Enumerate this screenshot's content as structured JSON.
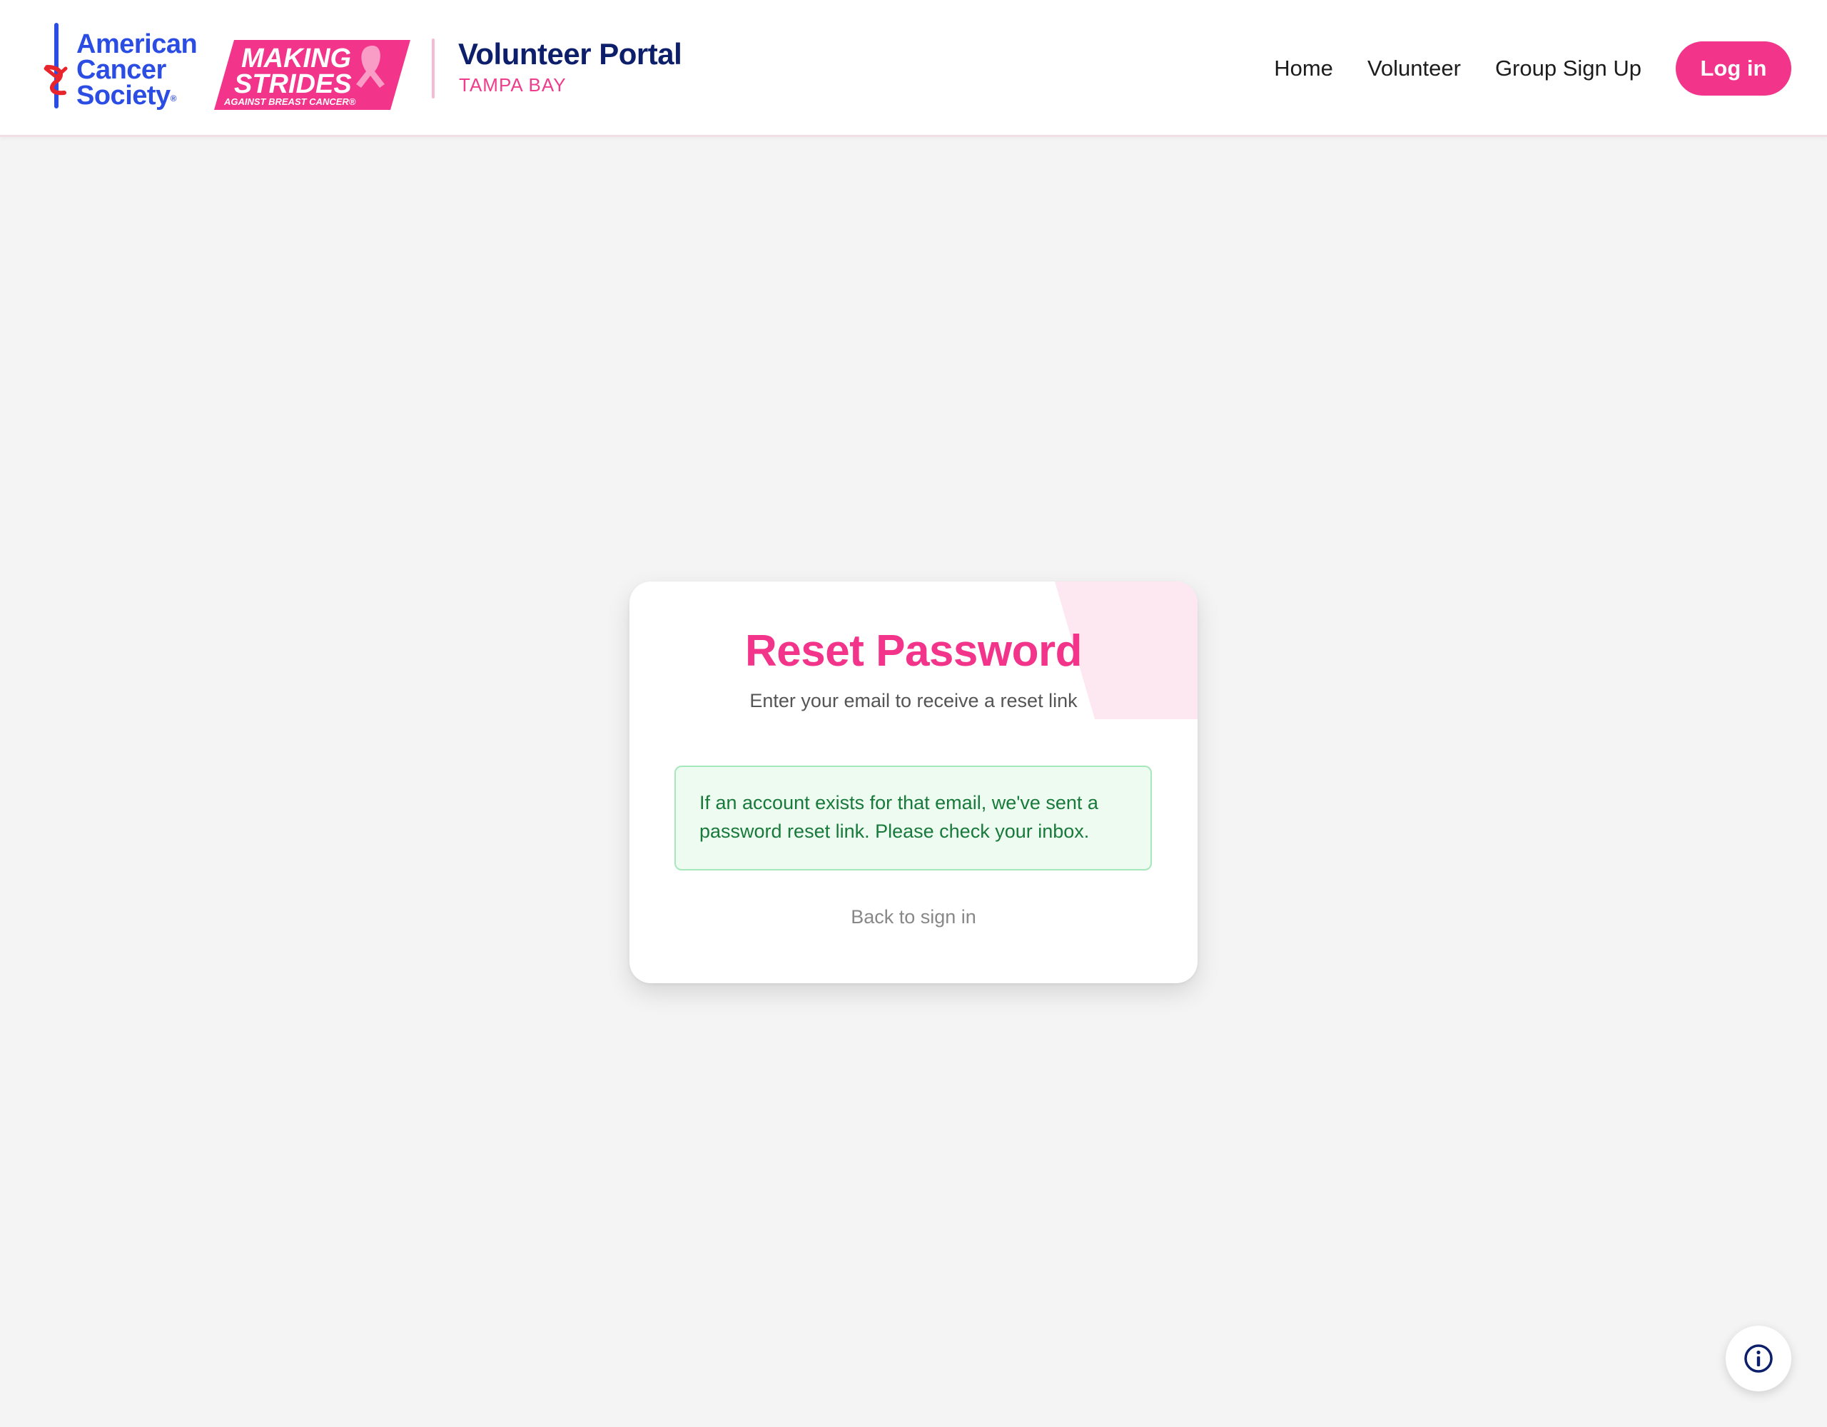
{
  "header": {
    "acs_logo": {
      "lines": [
        "American",
        "Cancer",
        "Society"
      ],
      "registered": "®",
      "color": "#2b4de3"
    },
    "strides_logo": {
      "lines": [
        "MAKING",
        "STRIDES",
        "AGAINST BREAST CANCER®"
      ],
      "color": "#f2348a"
    },
    "portal_title": "Volunteer Portal",
    "portal_subtitle": "TAMPA BAY",
    "nav": {
      "home": "Home",
      "volunteer": "Volunteer",
      "group_sign_up": "Group Sign Up",
      "login": "Log in"
    }
  },
  "card": {
    "title": "Reset Password",
    "subtitle": "Enter your email to receive a reset link",
    "success_message": "If an account exists for that email, we've sent a password reset link. Please check your inbox.",
    "back_link": "Back to sign in"
  },
  "info_button": {
    "icon": "info-icon",
    "color": "#0d1f6b"
  },
  "colors": {
    "accent": "#f2348a",
    "navy": "#0d1f6b",
    "success_text": "#187a3a",
    "success_bg": "#edfbf1"
  }
}
